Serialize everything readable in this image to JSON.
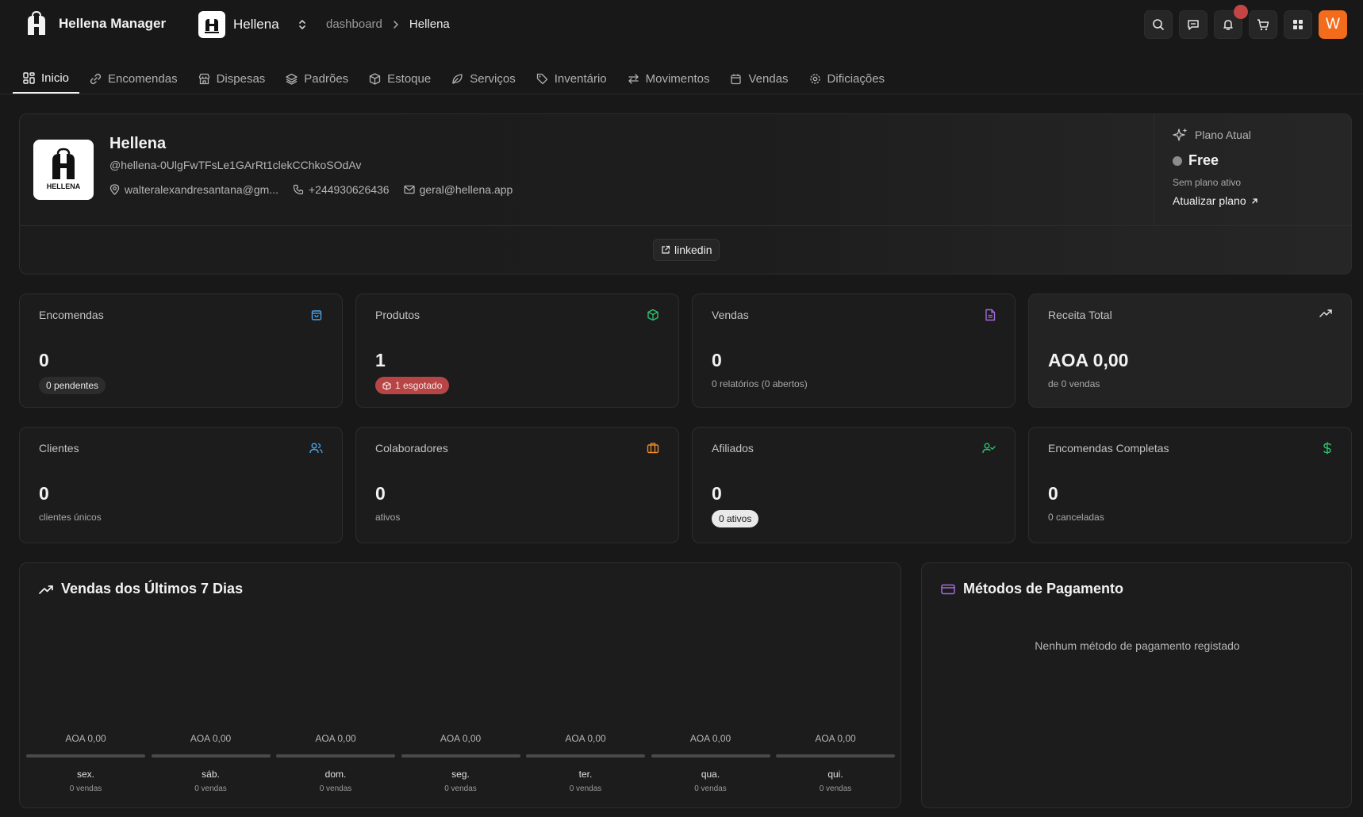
{
  "header": {
    "app_title": "Hellena Manager",
    "store_name": "Hellena",
    "breadcrumb": [
      "dashboard",
      "Hellena"
    ],
    "avatar_initial": "W"
  },
  "tabs": [
    {
      "label": "Inicio",
      "icon": "grid-icon",
      "active": true
    },
    {
      "label": "Encomendas",
      "icon": "link-icon"
    },
    {
      "label": "Dispesas",
      "icon": "store-icon"
    },
    {
      "label": "Padrões",
      "icon": "layers-icon"
    },
    {
      "label": "Estoque",
      "icon": "box-icon"
    },
    {
      "label": "Serviços",
      "icon": "leaf-icon"
    },
    {
      "label": "Inventário",
      "icon": "tag-icon"
    },
    {
      "label": "Movimentos",
      "icon": "arrows-icon"
    },
    {
      "label": "Vendas",
      "icon": "calendar-icon"
    },
    {
      "label": "Dificiações",
      "icon": "gear-icon"
    }
  ],
  "profile": {
    "logo_text": "HELLENA",
    "name": "Hellena",
    "handle": "@hellena-0UlgFwTFsLe1GArRt1clekCChkoSOdAv",
    "address": "walteralexandresantana@gm...",
    "phone": "+244930626436",
    "email": "geral@hellena.app",
    "social_link": "linkedin"
  },
  "plan": {
    "heading": "Plano Atual",
    "tier": "Free",
    "status": "Sem plano ativo",
    "upgrade_label": "Atualizar plano"
  },
  "stats": [
    {
      "title": "Encomendas",
      "value": "0",
      "sub": "0 pendentes",
      "sub_style": "pill-dark",
      "icon": "bag-icon",
      "color": "#4aa3e8"
    },
    {
      "title": "Produtos",
      "value": "1",
      "sub": "1 esgotado",
      "sub_style": "pill-red",
      "icon": "package-icon",
      "color": "#2fbf6b"
    },
    {
      "title": "Vendas",
      "value": "0",
      "sub": "0 relatórios (0 abertos)",
      "sub_style": "text",
      "icon": "file-icon",
      "color": "#a46ad9"
    },
    {
      "title": "Receita Total",
      "value": "AOA 0,00",
      "sub": "de 0 vendas",
      "sub_style": "text",
      "icon": "trend-icon",
      "color": "#e0e0e0"
    },
    {
      "title": "Clientes",
      "value": "0",
      "sub": "clientes únicos",
      "sub_style": "text",
      "icon": "users-icon",
      "color": "#4aa3e8"
    },
    {
      "title": "Colaboradores",
      "value": "0",
      "sub": "ativos",
      "sub_style": "text",
      "icon": "briefcase-icon",
      "color": "#f08a2c"
    },
    {
      "title": "Afiliados",
      "value": "0",
      "sub": "0 ativos",
      "sub_style": "pill-light",
      "icon": "user-check-icon",
      "color": "#2fbf6b"
    },
    {
      "title": "Encomendas Completas",
      "value": "0",
      "sub": "0 canceladas",
      "sub_style": "text",
      "icon": "dollar-icon",
      "color": "#2fbf6b"
    }
  ],
  "sales_panel": {
    "title": "Vendas dos Últimos 7 Dias",
    "days": [
      {
        "day": "sex.",
        "amount": "AOA 0,00",
        "count": "0 vendas"
      },
      {
        "day": "sáb.",
        "amount": "AOA 0,00",
        "count": "0 vendas"
      },
      {
        "day": "dom.",
        "amount": "AOA 0,00",
        "count": "0 vendas"
      },
      {
        "day": "seg.",
        "amount": "AOA 0,00",
        "count": "0 vendas"
      },
      {
        "day": "ter.",
        "amount": "AOA 0,00",
        "count": "0 vendas"
      },
      {
        "day": "qua.",
        "amount": "AOA 0,00",
        "count": "0 vendas"
      },
      {
        "day": "qui.",
        "amount": "AOA 0,00",
        "count": "0 vendas"
      }
    ]
  },
  "payment_panel": {
    "title": "Métodos de Pagamento",
    "empty_text": "Nenhum método de pagamento registado"
  }
}
